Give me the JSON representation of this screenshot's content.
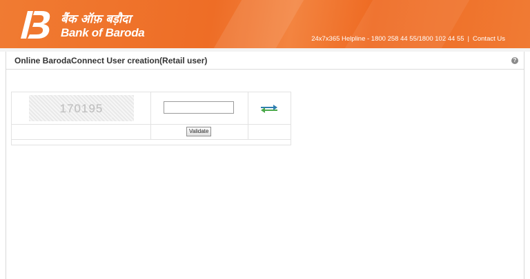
{
  "header": {
    "brand_hindi": "बैंक ऑफ़ बड़ौदा",
    "brand_english": "Bank of Baroda",
    "helpline": "24x7x365 Helpline - 1800 258 44 55/1800 102 44 55",
    "separator": "|",
    "contact_us": "Contact Us",
    "colors": {
      "header_bg": "#ee6d26",
      "header_text": "#ffffff"
    }
  },
  "panel": {
    "title": "Online BarodaConnect User creation(Retail user)",
    "help_icon": "question-icon"
  },
  "captcha": {
    "image_text": "170195",
    "input_value": "",
    "refresh_icon": "refresh-arrows-icon",
    "validate_label": "Validate"
  }
}
